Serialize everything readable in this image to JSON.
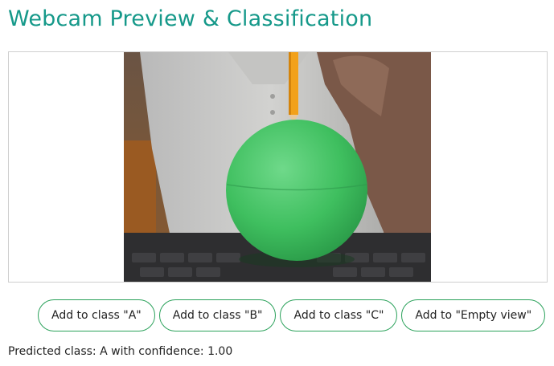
{
  "header": {
    "title": "Webcam Preview & Classification"
  },
  "preview": {
    "image_description_icon": "webcam-video-icon"
  },
  "buttons": [
    {
      "label": "Add to class \"A\""
    },
    {
      "label": "Add to class \"B\""
    },
    {
      "label": "Add to class \"C\""
    },
    {
      "label": "Add to \"Empty view\""
    }
  ],
  "prediction": {
    "text": "Predicted class: A with confidence: 1.00"
  },
  "colors": {
    "title": "#16998a",
    "button_border": "#2aa15a",
    "ball": "#3fbf5f"
  }
}
